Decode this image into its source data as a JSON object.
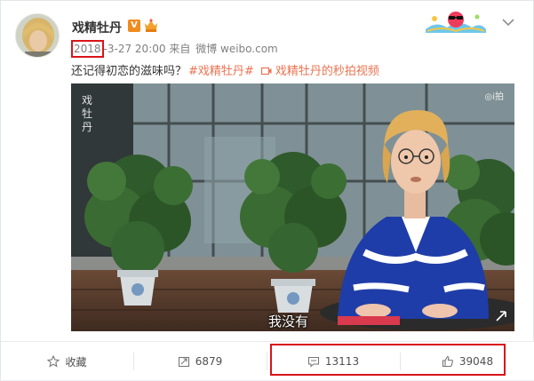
{
  "post": {
    "username": "戏精牡丹",
    "verified_badge": "V",
    "year": "2018",
    "date_rest": "-3-27 20:00",
    "source_prefix": "来自",
    "source": "微博 weibo.com",
    "text": "还记得初恋的滋味吗？",
    "topic": "#戏精牡丹#",
    "video_link": "戏精牡丹的秒拍视频"
  },
  "video": {
    "subtitle": "我没有",
    "watermark_top_right": "◎i拍",
    "watermark_top_left": "戏牡丹"
  },
  "actions": {
    "favorite": "收藏",
    "repost": "6879",
    "comment": "13113",
    "like": "39048"
  },
  "icons": [
    "avatar",
    "verified-icon",
    "vip-crown-icon",
    "sunglasses-sticker-icon",
    "chevron-down-icon",
    "video-icon",
    "star-icon",
    "repost-icon",
    "comment-icon",
    "thumbs-up-icon"
  ],
  "colors": {
    "accent": "#eb7350",
    "highlight_box": "#d9141a",
    "verified": "#f08b1e",
    "jacket_blue": "#1f3da8"
  }
}
